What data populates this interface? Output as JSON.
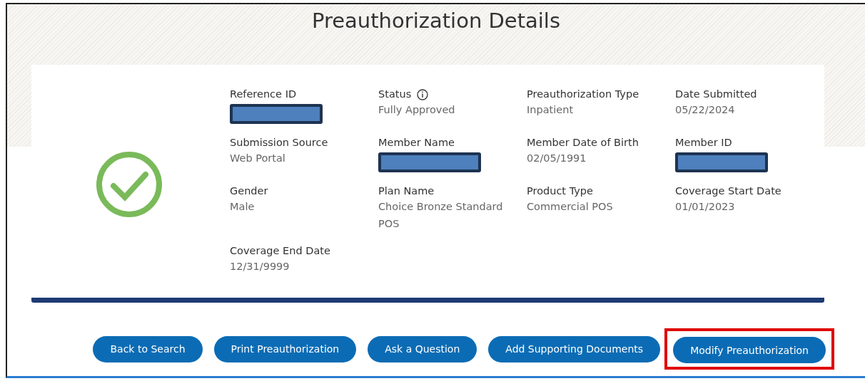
{
  "title": "Preauthorization Details",
  "status_icon": {
    "approved": true
  },
  "fields": [
    {
      "label": "Reference ID",
      "kind": "redacted"
    },
    {
      "label": "Status",
      "kind": "text",
      "value": "Fully Approved",
      "info": true
    },
    {
      "label": "Preauthorization Type",
      "kind": "text",
      "value": "Inpatient"
    },
    {
      "label": "Date Submitted",
      "kind": "text",
      "value": "05/22/2024"
    },
    {
      "label": "Submission Source",
      "kind": "text",
      "value": "Web Portal"
    },
    {
      "label": "Member Name",
      "kind": "redacted"
    },
    {
      "label": "Member Date of Birth",
      "kind": "text",
      "value": "02/05/1991"
    },
    {
      "label": "Member ID",
      "kind": "redacted"
    },
    {
      "label": "Gender",
      "kind": "text",
      "value": "Male"
    },
    {
      "label": "Plan Name",
      "kind": "text",
      "value": "Choice Bronze Standard POS"
    },
    {
      "label": "Product Type",
      "kind": "text",
      "value": "Commercial POS"
    },
    {
      "label": "Coverage Start Date",
      "kind": "text",
      "value": "01/01/2023"
    },
    {
      "label": "Coverage End Date",
      "kind": "text",
      "value": "12/31/9999"
    }
  ],
  "buttons": [
    {
      "label": "Back to Search",
      "highlighted": false
    },
    {
      "label": "Print Preauthorization",
      "highlighted": false
    },
    {
      "label": "Ask a Question",
      "highlighted": false
    },
    {
      "label": "Add Supporting Documents",
      "highlighted": false
    },
    {
      "label": "Modify Preauthorization",
      "highlighted": true
    }
  ]
}
